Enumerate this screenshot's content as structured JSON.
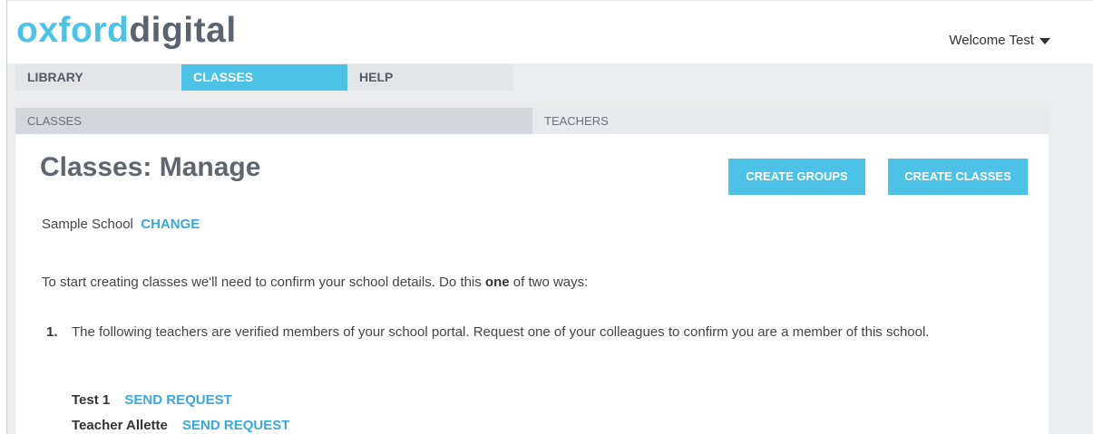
{
  "header": {
    "logo_part1": "oxford",
    "logo_part2": "digital",
    "welcome": "Welcome Test"
  },
  "main_nav": [
    {
      "label": "LIBRARY",
      "active": false
    },
    {
      "label": "CLASSES",
      "active": true
    },
    {
      "label": "HELP",
      "active": false
    }
  ],
  "sub_nav": [
    {
      "label": "CLASSES",
      "active": true
    },
    {
      "label": "TEACHERS",
      "active": false
    }
  ],
  "page": {
    "title": "Classes: Manage",
    "create_groups": "CREATE GROUPS",
    "create_classes": "CREATE CLASSES",
    "school_name": "Sample School",
    "change_link": "CHANGE",
    "intro_before": "To start creating classes we'll need to confirm your school details. Do this ",
    "intro_bold": "one",
    "intro_after": " of two ways:",
    "step1_number": "1.",
    "step1_text": "The following teachers are verified members of your school portal. Request one of your colleagues to confirm you are a member of this school.",
    "teachers": [
      {
        "name": "Test 1",
        "action": "SEND REQUEST"
      },
      {
        "name": "Teacher Allette",
        "action": "SEND REQUEST"
      }
    ]
  },
  "colors": {
    "accent": "#4cc3e6",
    "link": "#3aa8d8",
    "logo_dark": "#5a6470"
  }
}
